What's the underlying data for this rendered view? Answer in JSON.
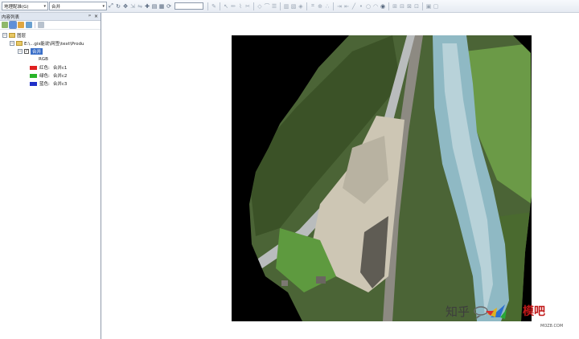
{
  "toolbar": {
    "georef_label": "地理配准(G)",
    "georef_arrow": "▾",
    "layer_value": "合并",
    "layer_arrow": "▾"
  },
  "toc": {
    "title": "内容列表",
    "pin": "ᵖ",
    "close": "×",
    "root_label": "图层",
    "folder_path": "E:\\...gis能说\\网签\\text\\Produ",
    "layer_name": "合并",
    "rgb_label": "RGB",
    "bands": [
      {
        "label": "红色:",
        "value": "合并c1",
        "color": "#e02020"
      },
      {
        "label": "绿色:",
        "value": "合并c2",
        "color": "#28b428"
      },
      {
        "label": "蓝色:",
        "value": "合并c3",
        "color": "#2030c8"
      }
    ]
  },
  "watermark": {
    "zhihu": "知乎",
    "site_name": "模吧",
    "site_url": "MOZ8.COM"
  },
  "colors": {
    "panel_header": "#dfe6f0",
    "selection": "#3a6fc8",
    "map_background": "#000000"
  }
}
